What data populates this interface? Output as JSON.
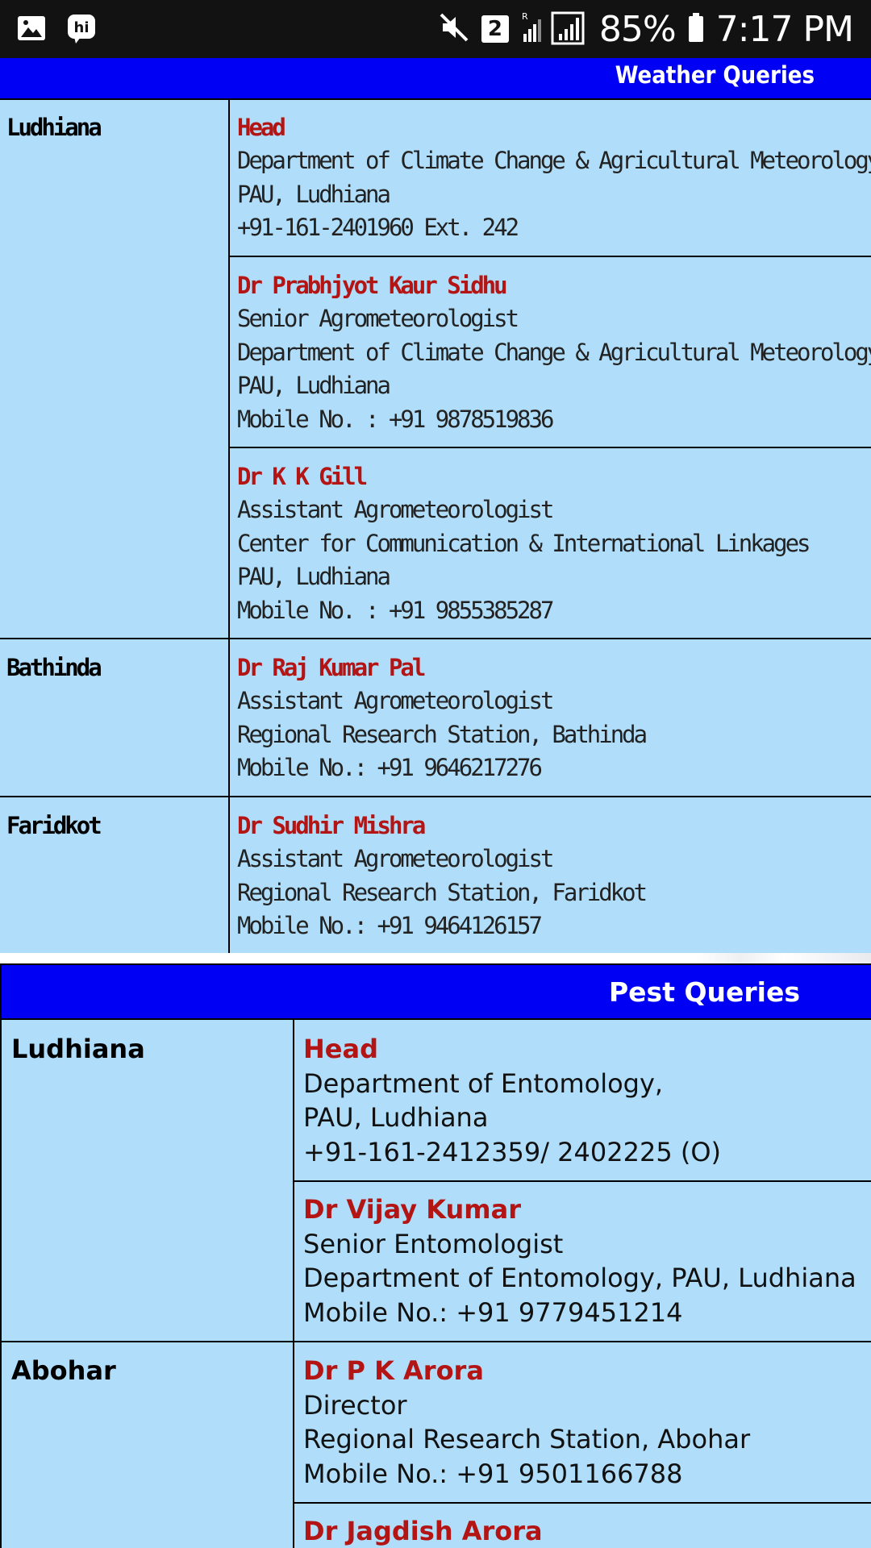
{
  "status_bar": {
    "battery": "85%",
    "time": "7:17 PM",
    "sim_badge": "2",
    "icons": [
      "gallery-icon",
      "hike-icon",
      "mute-icon",
      "signal-icon",
      "battery-icon"
    ]
  },
  "weather": {
    "header": "Weather Queries",
    "ludhiana": {
      "city": "Ludhiana",
      "contacts": [
        {
          "name": "Head",
          "lines": [
            "Department of Climate Change & Agricultural Meteorology",
            "PAU, Ludhiana",
            "+91-161-2401960 Ext. 242"
          ]
        },
        {
          "name": "Dr Prabhjyot Kaur Sidhu",
          "lines": [
            "Senior Agrometeorologist",
            "Department of Climate Change & Agricultural Meteorology",
            "PAU, Ludhiana",
            "Mobile No. : +91 9878519836"
          ]
        },
        {
          "name": "Dr K K Gill",
          "lines": [
            "Assistant Agrometeorologist",
            "Center for Communication & International Linkages",
            "PAU, Ludhiana",
            "Mobile No. : +91 9855385287"
          ]
        }
      ]
    },
    "bathinda": {
      "city": "Bathinda",
      "contacts": [
        {
          "name": "Dr Raj Kumar Pal",
          "lines": [
            "Assistant Agrometeorologist",
            "Regional Research Station, Bathinda",
            "Mobile No.: +91 9646217276"
          ]
        }
      ]
    },
    "faridkot": {
      "city": "Faridkot",
      "contacts": [
        {
          "name": "Dr Sudhir Mishra",
          "lines": [
            "Assistant Agrometeorologist",
            "Regional Research Station, Faridkot",
            "Mobile No.: +91 9464126157"
          ]
        }
      ]
    }
  },
  "pest": {
    "header": "Pest Queries",
    "ludhiana": {
      "city": "Ludhiana",
      "contacts": [
        {
          "name": "Head",
          "lines": [
            "Department of Entomology,",
            "PAU, Ludhiana",
            "+91-161-2412359/ 2402225 (O)"
          ]
        },
        {
          "name": "Dr Vijay Kumar",
          "lines": [
            "Senior Entomologist",
            "Department of Entomology, PAU, Ludhiana",
            "Mobile No.: +91 9779451214"
          ]
        }
      ]
    },
    "abohar": {
      "city": "Abohar",
      "contacts": [
        {
          "name": "Dr P K Arora",
          "lines": [
            "Director",
            "Regional Research Station, Abohar",
            "Mobile No.: +91 9501166788"
          ]
        },
        {
          "name": "Dr Jagdish Arora",
          "lines": []
        }
      ]
    }
  }
}
